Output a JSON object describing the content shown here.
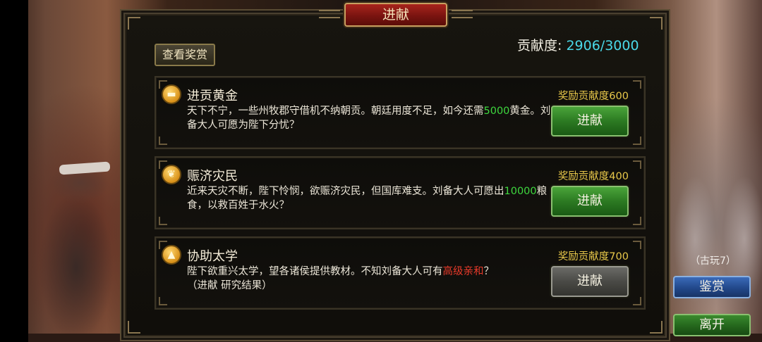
{
  "panel": {
    "title": "进献",
    "view_rewards_label": "查看奖赏",
    "contribution_label": "贡献度:",
    "contribution_value": "2906/3000"
  },
  "tasks": [
    {
      "title": "进贡黄金",
      "icon": "gold-ingot-icon",
      "desc_a": "天下不宁，一些州牧郡守借机不纳朝贡。朝廷用度不足，如今还需",
      "desc_highlight": "5000",
      "desc_b": "黄金。刘备大人可愿为陛下分忧？",
      "reward": "奖励贡献度600",
      "button": "进献",
      "button_state": "active"
    },
    {
      "title": "赈济灾民",
      "icon": "grain-icon",
      "desc_a": "近来天灾不断，陛下怜悯，欲赈济灾民，但国库难支。刘备大人可愿出",
      "desc_highlight": "10000",
      "desc_b": "粮食，以救百姓于水火？",
      "reward": "奖励贡献度400",
      "button": "进献",
      "button_state": "active"
    },
    {
      "title": "协助太学",
      "icon": "scholar-icon",
      "desc_a": "陛下欲重兴太学，望各诸侯提供教材。不知刘备大人可有",
      "desc_highlight": "高级亲和",
      "desc_b": "？",
      "desc_c": "（进献 研究结果）",
      "reward": "奖励贡献度700",
      "button": "进献",
      "button_state": "disabled"
    }
  ],
  "side": {
    "note": "（古玩7）",
    "appreciate_label": "鉴赏",
    "leave_label": "离开"
  },
  "colors": {
    "highlight_green": "#3ed83e",
    "highlight_red": "#e83a2a",
    "reward_gold": "#e8c84a",
    "contribution_cyan": "#4ad8e8"
  }
}
